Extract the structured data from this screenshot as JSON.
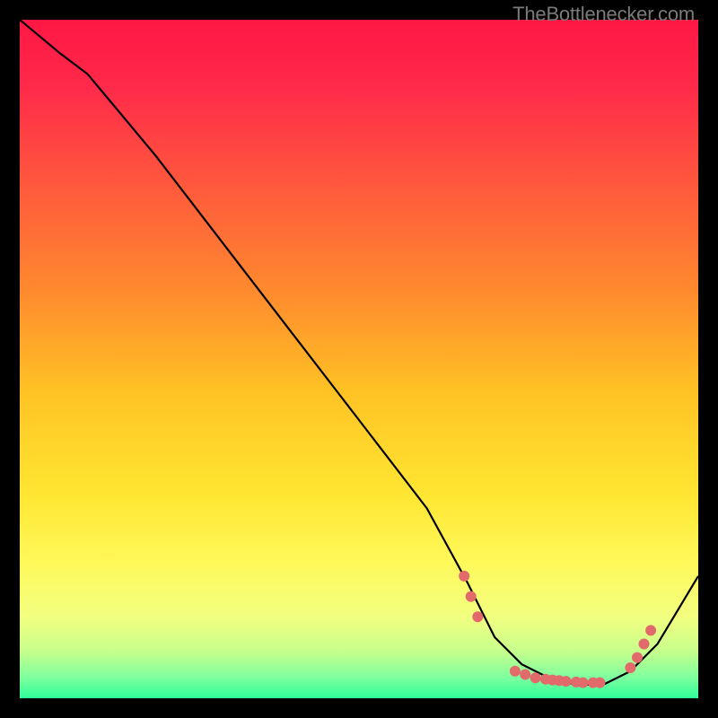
{
  "watermark": "TheBottlenecker.com",
  "chart_data": {
    "type": "line",
    "title": "",
    "xlabel": "",
    "ylabel": "",
    "xlim": [
      0,
      100
    ],
    "ylim": [
      0,
      100
    ],
    "grid": false,
    "series": [
      {
        "name": "curve",
        "x": [
          0,
          6,
          10,
          20,
          30,
          40,
          50,
          60,
          66,
          70,
          74,
          78,
          82,
          86,
          90,
          94,
          100
        ],
        "y": [
          100,
          95,
          92,
          80,
          67,
          54,
          41,
          28,
          17,
          9,
          5,
          3,
          2,
          2,
          4,
          8,
          18
        ]
      }
    ],
    "markers": {
      "name": "dots",
      "x": [
        65.5,
        66.5,
        67.5,
        73,
        74.5,
        76,
        77.5,
        78.5,
        79.5,
        80.5,
        82,
        83,
        84.5,
        85.5,
        90,
        91,
        92,
        93
      ],
      "y": [
        18,
        15,
        12,
        4,
        3.5,
        3,
        2.8,
        2.7,
        2.6,
        2.5,
        2.4,
        2.3,
        2.3,
        2.3,
        4.5,
        6,
        8,
        10
      ]
    },
    "gradient_stops": [
      {
        "offset": 0.0,
        "color": "#ff1744"
      },
      {
        "offset": 0.1,
        "color": "#ff2a4a"
      },
      {
        "offset": 0.25,
        "color": "#ff5a3c"
      },
      {
        "offset": 0.4,
        "color": "#ff8a2e"
      },
      {
        "offset": 0.55,
        "color": "#ffc324"
      },
      {
        "offset": 0.7,
        "color": "#ffe632"
      },
      {
        "offset": 0.8,
        "color": "#fff95a"
      },
      {
        "offset": 0.88,
        "color": "#f2ff80"
      },
      {
        "offset": 0.93,
        "color": "#c8ff8c"
      },
      {
        "offset": 0.97,
        "color": "#7dff9e"
      },
      {
        "offset": 1.0,
        "color": "#2eff9a"
      }
    ],
    "marker_color": "#e26a6a",
    "line_color": "#000000"
  }
}
